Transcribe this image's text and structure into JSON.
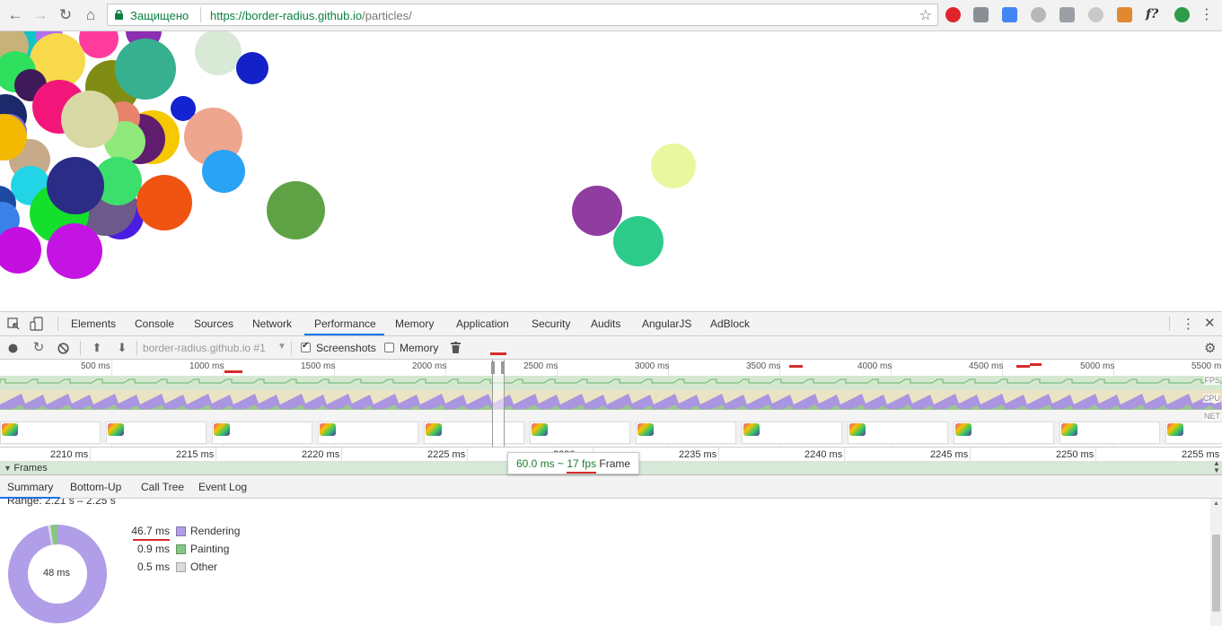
{
  "browser": {
    "secure_label": "Защищено",
    "url_host": "https://border-radius.github.io",
    "url_path": "/particles/"
  },
  "devtools": {
    "tabs": [
      "Elements",
      "Console",
      "Sources",
      "Network",
      "Performance",
      "Memory",
      "Application",
      "Security",
      "Audits",
      "AngularJS",
      "AdBlock"
    ],
    "active_tab": "Performance",
    "toolbar": {
      "profile_select": "border-radius.github.io #1",
      "screenshots_label": "Screenshots",
      "screenshots_checked": true,
      "memory_label": "Memory",
      "memory_checked": false
    },
    "overview": {
      "ticks": [
        "500 ms",
        "1000 ms",
        "1500 ms",
        "2000 ms",
        "2500 ms",
        "3000 ms",
        "3500 ms",
        "4000 ms",
        "4500 ms",
        "5000 ms",
        "5500 ms"
      ],
      "lanes": [
        "FPS",
        "CPU",
        "NET"
      ]
    },
    "ruler": {
      "ticks": [
        "2210 ms",
        "2215 ms",
        "2220 ms",
        "2225 ms",
        "2230 ms",
        "2235 ms",
        "2240 ms",
        "2245 ms",
        "2250 ms",
        "2255 ms"
      ]
    },
    "frames_label": "Frames",
    "tooltip": {
      "duration": "60.0 ms ~",
      "fps": "17 fps",
      "kind": "Frame"
    },
    "bottom_tabs": [
      "Summary",
      "Bottom-Up",
      "Call Tree",
      "Event Log"
    ],
    "active_bottom_tab": "Summary",
    "summary": {
      "range": "Range: 2.21 s – 2.25 s",
      "total": "48 ms",
      "items": [
        {
          "value": "46.7 ms",
          "label": "Rendering",
          "color": "#b09ee8"
        },
        {
          "value": "0.9 ms",
          "label": "Painting",
          "color": "#86c783"
        },
        {
          "value": "0.5 ms",
          "label": "Other",
          "color": "#dcdcdc"
        }
      ]
    }
  },
  "colors": {
    "accent": "#1a73e8",
    "annotation_red": "#d62b2b",
    "rendering": "#b09ee8",
    "painting": "#86c783"
  }
}
